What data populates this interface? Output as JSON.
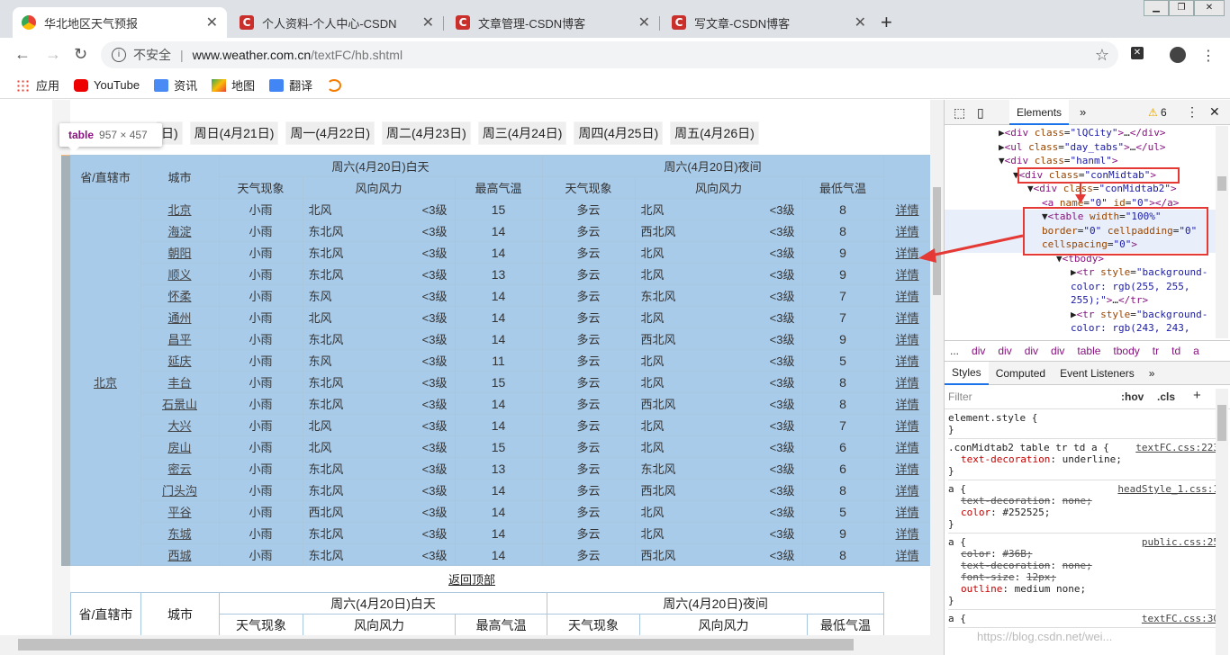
{
  "tabs": [
    {
      "label": "华北地区天气预报"
    },
    {
      "label": "个人资料-个人中心-CSDN"
    },
    {
      "label": "文章管理-CSDN博客"
    },
    {
      "label": "写文章-CSDN博客"
    }
  ],
  "omnibox": {
    "security": "不安全",
    "url_host": "www.weather.com.cn",
    "url_path": "/textFC/hb.shtml"
  },
  "bookmarks": [
    {
      "label": "应用"
    },
    {
      "label": "YouTube"
    },
    {
      "label": "资讯"
    },
    {
      "label": "地图"
    },
    {
      "label": "翻译"
    }
  ],
  "tooltip": {
    "tag": "table",
    "size": "957 × 457"
  },
  "day_tabs": [
    "周日(4月21日)",
    "周一(4月22日)",
    "周二(4月23日)",
    "周三(4月24日)",
    "周四(4月25日)",
    "周五(4月26日)"
  ],
  "day_tab_partial": "日)",
  "table": {
    "h_province": "省/直辖市",
    "h_city": "城市",
    "h_day": "周六(4月20日)白天",
    "h_night": "周六(4月20日)夜间",
    "h_weather": "天气现象",
    "h_wind": "风向风力",
    "h_max": "最高气温",
    "h_min": "最低气温",
    "province": "北京",
    "detail": "详情",
    "rows": [
      [
        "北京",
        "小雨",
        "北风",
        "<3级",
        "15",
        "多云",
        "北风",
        "<3级",
        "8"
      ],
      [
        "海淀",
        "小雨",
        "东北风",
        "<3级",
        "14",
        "多云",
        "西北风",
        "<3级",
        "8"
      ],
      [
        "朝阳",
        "小雨",
        "东北风",
        "<3级",
        "14",
        "多云",
        "北风",
        "<3级",
        "9"
      ],
      [
        "顺义",
        "小雨",
        "东北风",
        "<3级",
        "13",
        "多云",
        "北风",
        "<3级",
        "9"
      ],
      [
        "怀柔",
        "小雨",
        "东风",
        "<3级",
        "14",
        "多云",
        "东北风",
        "<3级",
        "7"
      ],
      [
        "通州",
        "小雨",
        "北风",
        "<3级",
        "14",
        "多云",
        "北风",
        "<3级",
        "7"
      ],
      [
        "昌平",
        "小雨",
        "东北风",
        "<3级",
        "14",
        "多云",
        "西北风",
        "<3级",
        "9"
      ],
      [
        "延庆",
        "小雨",
        "东风",
        "<3级",
        "11",
        "多云",
        "北风",
        "<3级",
        "5"
      ],
      [
        "丰台",
        "小雨",
        "东北风",
        "<3级",
        "15",
        "多云",
        "北风",
        "<3级",
        "8"
      ],
      [
        "石景山",
        "小雨",
        "东北风",
        "<3级",
        "14",
        "多云",
        "西北风",
        "<3级",
        "8"
      ],
      [
        "大兴",
        "小雨",
        "北风",
        "<3级",
        "14",
        "多云",
        "北风",
        "<3级",
        "7"
      ],
      [
        "房山",
        "小雨",
        "北风",
        "<3级",
        "15",
        "多云",
        "北风",
        "<3级",
        "6"
      ],
      [
        "密云",
        "小雨",
        "东北风",
        "<3级",
        "13",
        "多云",
        "东北风",
        "<3级",
        "6"
      ],
      [
        "门头沟",
        "小雨",
        "东北风",
        "<3级",
        "14",
        "多云",
        "西北风",
        "<3级",
        "8"
      ],
      [
        "平谷",
        "小雨",
        "西北风",
        "<3级",
        "14",
        "多云",
        "北风",
        "<3级",
        "5"
      ],
      [
        "东城",
        "小雨",
        "东北风",
        "<3级",
        "14",
        "多云",
        "北风",
        "<3级",
        "9"
      ],
      [
        "西城",
        "小雨",
        "东北风",
        "<3级",
        "14",
        "多云",
        "西北风",
        "<3级",
        "8"
      ]
    ],
    "back_top": "返回顶部"
  },
  "devtools": {
    "tab_elements": "Elements",
    "warn_count": "6",
    "dom": [
      {
        "indent": 5,
        "html": "▶<span class='tg'>&lt;div</span> <span class='an'>class</span>=<span class='av'>\"lQCity\"</span><span class='tg'>&gt;</span>…<span class='tg'>&lt;/div&gt;</span>"
      },
      {
        "indent": 5,
        "html": "▶<span class='tg'>&lt;ul</span> <span class='an'>class</span>=<span class='av'>\"day_tabs\"</span><span class='tg'>&gt;</span>…<span class='tg'>&lt;/ul&gt;</span>"
      },
      {
        "indent": 5,
        "html": "▼<span class='tg'>&lt;div</span> <span class='an'>class</span>=<span class='av'>\"hanml\"</span><span class='tg'>&gt;</span>"
      },
      {
        "indent": 7,
        "html": "▼<span class='tg'>&lt;div</span> <span class='an'>class</span>=<span class='av'>\"conMidtab\"</span><span class='tg'>&gt;</span>"
      },
      {
        "indent": 9,
        "html": "▼<span class='tg'>&lt;div</span> <span class='an'>class</span>=<span class='av'>\"conMidtab2\"</span><span class='tg'>&gt;</span>"
      },
      {
        "indent": 11,
        "html": "<span class='tg'>&lt;a</span> <span class='an'>name</span>=<span class='av'>\"0\"</span> <span class='an'>id</span>=<span class='av'>\"0\"</span><span class='tg'>&gt;&lt;/a&gt;</span>"
      },
      {
        "indent": 11,
        "html": "▼<span class='tg'>&lt;table</span> <span class='an'>width</span>=<span class='av'>\"100%\"</span>"
      },
      {
        "indent": 11,
        "html": "<span class='an'>border</span>=<span class='av'>\"0\"</span> <span class='an'>cellpadding</span>=<span class='av'>\"0\"</span>"
      },
      {
        "indent": 11,
        "html": "<span class='an'>cellspacing</span>=<span class='av'>\"0\"</span><span class='tg'>&gt;</span>"
      },
      {
        "indent": 13,
        "html": "▼<span class='tg'>&lt;tbody&gt;</span>"
      },
      {
        "indent": 15,
        "html": "▶<span class='tg'>&lt;tr</span> <span class='an'>style</span>=<span class='av'>\"background-</span>"
      },
      {
        "indent": 15,
        "html": "<span class='av'>color: rgb(255, 255,</span>"
      },
      {
        "indent": 15,
        "html": "<span class='av'>255);\"</span><span class='tg'>&gt;</span>…<span class='tg'>&lt;/tr&gt;</span>"
      },
      {
        "indent": 15,
        "html": "▶<span class='tg'>&lt;tr</span> <span class='an'>style</span>=<span class='av'>\"background-</span>"
      },
      {
        "indent": 15,
        "html": "<span class='av'>color: rgb(243, 243,</span>"
      }
    ],
    "crumbs": [
      "...",
      "div",
      "div",
      "div",
      "div",
      "table",
      "tbody",
      "tr",
      "td",
      "a"
    ],
    "style_tabs": [
      "Styles",
      "Computed",
      "Event Listeners"
    ],
    "filter": "Filter",
    "hov": ":hov",
    "cls": ".cls",
    "rules": [
      {
        "sel": "element.style {",
        "src": "",
        "props": []
      },
      {
        "sel": ".conMidtab2 table tr td a {",
        "src": "textFC.css:223",
        "props": [
          {
            "p": "text-decoration",
            "v": "underline;",
            "s": false
          }
        ]
      },
      {
        "sel": "a {",
        "src": "headStyle_1.css:1",
        "props": [
          {
            "p": "text-decoration",
            "v": "none;",
            "s": true
          },
          {
            "p": "color",
            "v": "#252525;",
            "s": false
          }
        ]
      },
      {
        "sel": "a {",
        "src": "public.css:25",
        "props": [
          {
            "p": "color",
            "v": "#36B;",
            "s": true
          },
          {
            "p": "text-decoration",
            "v": "none;",
            "s": true
          },
          {
            "p": "font-size",
            "v": "12px;",
            "s": true
          },
          {
            "p": "outline",
            "v": "medium none;",
            "s": false
          }
        ]
      },
      {
        "sel": "a {",
        "src": "textFC.css:30",
        "props": []
      }
    ]
  },
  "watermark": "https://blog.csdn.net/wei..."
}
